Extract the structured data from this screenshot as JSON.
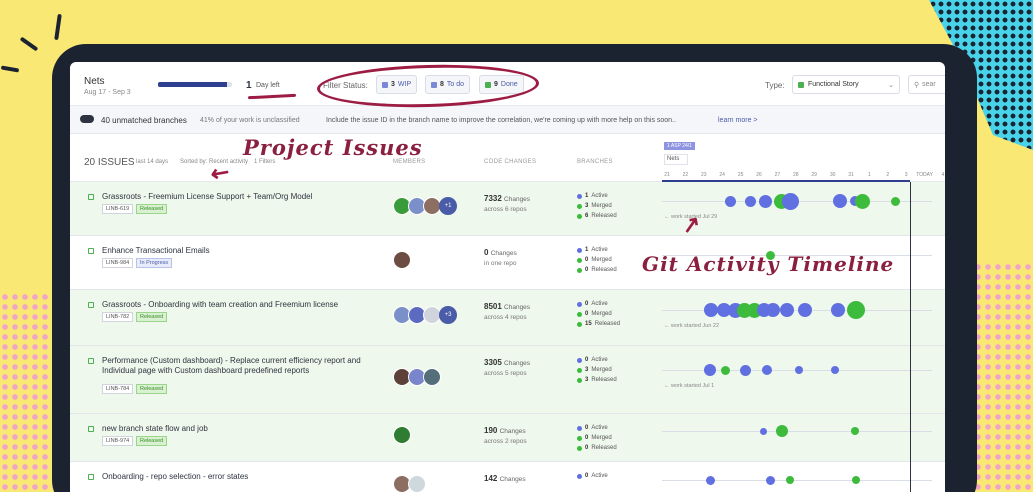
{
  "header": {
    "sprint_name": "Nets",
    "sprint_dates": "Aug 17 - Sep 3",
    "progress_fraction": 0.93,
    "days_left_num": "1",
    "days_left_label": "Day left",
    "filter_label": "Filter Status:",
    "filters": [
      {
        "count": "3",
        "label": "WIP",
        "color": "#7b88d6"
      },
      {
        "count": "8",
        "label": "To do",
        "color": "#7b88d6"
      },
      {
        "count": "9",
        "label": "Done",
        "color": "#4caf50"
      }
    ],
    "type_label": "Type:",
    "type_value": "Functional Story",
    "search_placeholder": "sear"
  },
  "banner": {
    "title": "40 unmatched branches",
    "subtitle": "41% of your work is unclassified",
    "message": "Include the issue ID in the branch name to improve the correlation, we're coming up with more help on this soon..",
    "link": "learn more >"
  },
  "table": {
    "count": "20 ISSUES",
    "period": "last 14 days",
    "sorted": "Sorted by: Recent activity",
    "filters": "1 Filters",
    "col_members": "MEMBERS",
    "col_changes": "CODE CHANGES",
    "col_branches": "BRANCHES",
    "sprint_tag": "1 ASP 24/1",
    "sprint_box": "Nets",
    "ticks": [
      "21",
      "22",
      "23",
      "24",
      "25",
      "26",
      "27",
      "28",
      "29",
      "30",
      "31",
      "1",
      "2",
      "3",
      "TODAY",
      "4"
    ]
  },
  "issues": [
    {
      "title": "Grassroots - Freemium License Support + Team/Org Model",
      "id": "LINB-619",
      "status": "Released",
      "changes": "7332",
      "changes_word": "Changes",
      "repos": "across 6 repos",
      "active": "1",
      "merged": "3",
      "released": "6",
      "work_started": "work started Jul 29",
      "extra": "+1",
      "avatars": 3
    },
    {
      "title": "Enhance Transactional Emails",
      "id": "LINB-984",
      "status": "In Progress",
      "changes": "0",
      "changes_word": "Changes",
      "repos": "in one repo",
      "active": "1",
      "merged": "0",
      "released": "0",
      "work_started": "",
      "extra": "",
      "avatars": 1
    },
    {
      "title": "Grassroots - Onboarding with team creation and Freemium license",
      "id": "LINB-782",
      "status": "Released",
      "changes": "8501",
      "changes_word": "Changes",
      "repos": "across 4 repos",
      "active": "0",
      "merged": "0",
      "released": "15",
      "work_started": "work started Jun 22",
      "extra": "+3",
      "avatars": 3
    },
    {
      "title": "Performance (Custom dashboard) - Replace current efficiency report and Individual page with Custom dashboard predefined reports",
      "id": "LINB-784",
      "status": "Released",
      "changes": "3305",
      "changes_word": "Changes",
      "repos": "across 5 repos",
      "active": "0",
      "merged": "3",
      "released": "3",
      "work_started": "work started Jul 1",
      "extra": "",
      "avatars": 3
    },
    {
      "title": "new branch state flow and job",
      "id": "LINB-974",
      "status": "Released",
      "changes": "190",
      "changes_word": "Changes",
      "repos": "across 2 repos",
      "active": "0",
      "merged": "0",
      "released": "0",
      "work_started": "",
      "extra": "",
      "avatars": 1
    },
    {
      "title": "Onboarding - repo selection - error states",
      "id": "",
      "status": "",
      "changes": "142",
      "changes_word": "Changes",
      "repos": "",
      "active": "0",
      "merged": "",
      "released": "",
      "work_started": "",
      "extra": "",
      "avatars": 2
    }
  ],
  "branch_labels": {
    "active": "Active",
    "merged": "Merged",
    "released": "Released"
  },
  "annotations": {
    "project_issues": "Project Issues",
    "git_timeline": "Git Activity Timeline"
  },
  "colors": {
    "background": "#f9e873",
    "accent": "#9c1c43",
    "blue_dot": "#6170e0",
    "green_dot": "#3dbb3d",
    "row_highlight": "#eff8ec"
  }
}
